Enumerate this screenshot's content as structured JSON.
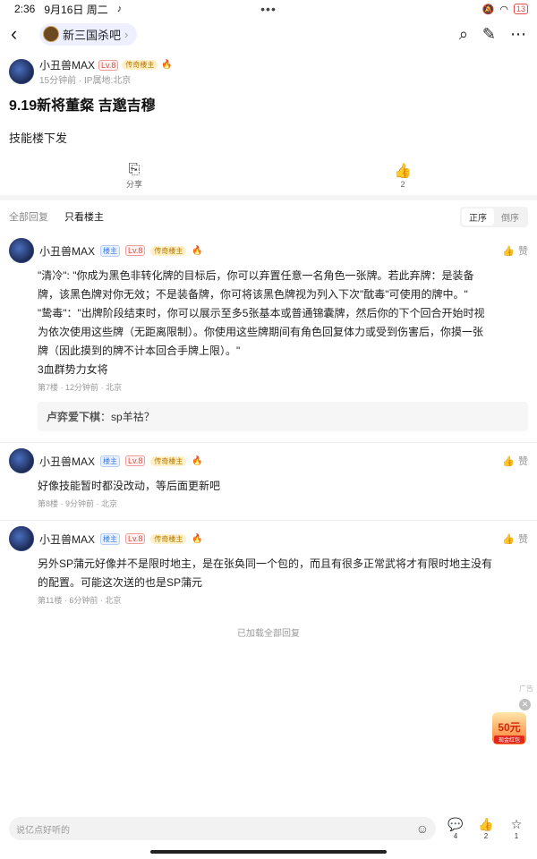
{
  "status_bar": {
    "time": "2:36",
    "date": "9月16日 周二",
    "battery": "13"
  },
  "nav": {
    "forum_name": "新三国杀吧"
  },
  "post": {
    "author": "小丑兽MAX",
    "level": "Lv.8",
    "badge": "传奇楼主",
    "meta": "15分钟前 · IP属地:北京",
    "title": "9.19新将董粲 吉邈吉穆",
    "body": "技能楼下发",
    "share_label": "分享",
    "like_count": "2"
  },
  "filter": {
    "tab_all": "全部回复",
    "tab_owner": "只看楼主",
    "sort_asc": "正序",
    "sort_desc": "倒序"
  },
  "replies": [
    {
      "author": "小丑兽MAX",
      "owner_tag": "楼主",
      "level": "Lv.8",
      "badge": "传奇楼主",
      "like_label": "赞",
      "lines": [
        "\"清冷\": \"你成为黑色非转化牌的目标后，你可以弃置任意一名角色一张牌。若此弃牌：是装备",
        "牌，该黑色牌对你无效；不是装备牌，你可将该黑色牌视为列入下次\"酖毒\"可使用的牌中。\"",
        "\"鸷毒\"：\"出牌阶段结束时，你可以展示至多5张基本或普通锦囊牌，然后你的下个回合开始时视",
        "为依次使用这些牌（无距离限制）。你使用这些牌期间有角色回复体力或受到伤害后，你摸一张",
        "牌（因此摸到的牌不计本回合手牌上限）。\"",
        "3血群势力女将"
      ],
      "meta": "第7楼 · 12分钟前 · 北京",
      "sub_author": "卢弈爱下棋",
      "sub_text": "sp羊祜？"
    },
    {
      "author": "小丑兽MAX",
      "owner_tag": "楼主",
      "level": "Lv.8",
      "badge": "传奇楼主",
      "like_label": "赞",
      "lines": [
        "好像技能暂时都没改动，等后面更新吧"
      ],
      "meta": "第8楼 · 9分钟前 · 北京"
    },
    {
      "author": "小丑兽MAX",
      "owner_tag": "楼主",
      "level": "Lv.8",
      "badge": "传奇楼主",
      "like_label": "赞",
      "lines": [
        "另外SP蒲元好像并不是限时地主，是在张奂同一个包的，而且有很多正常武将才有限时地主没有",
        "的配置。可能这次送的也是SP蒲元"
      ],
      "meta": "第11楼 · 6分钟前 · 北京"
    }
  ],
  "loaded_all": "已加载全部回复",
  "ad": {
    "label": "广告",
    "amount": "50元",
    "text": "现金红包"
  },
  "bottom": {
    "placeholder": "说亿点好听的",
    "reply_count": "4",
    "like_count": "2",
    "fav_count": "1"
  }
}
